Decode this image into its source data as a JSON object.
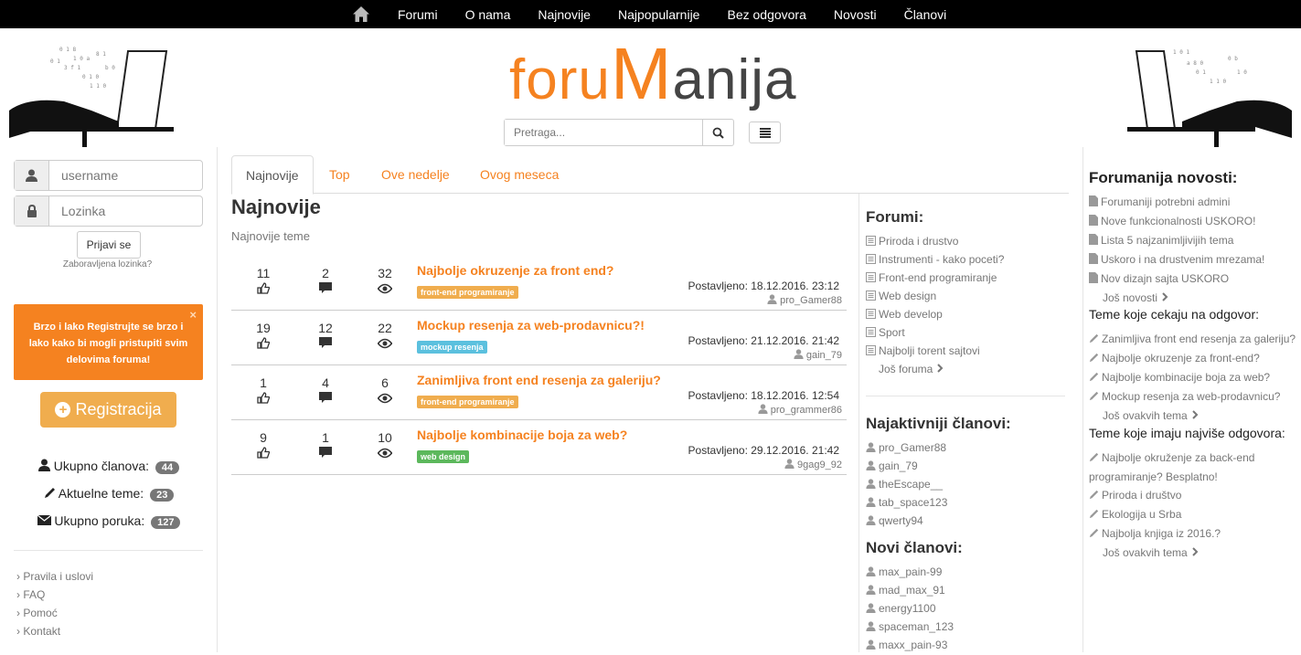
{
  "topnav": {
    "items": [
      "Forumi",
      "O nama",
      "Najnovije",
      "Najpopularnije",
      "Bez odgovora",
      "Novosti",
      "Članovi"
    ]
  },
  "logo": {
    "part1": "foru",
    "part2": "M",
    "part3": "anija"
  },
  "search": {
    "placeholder": "Pretraga..."
  },
  "login": {
    "username_placeholder": "username",
    "password_placeholder": "Lozinka",
    "button": "Prijavi se",
    "forgot": "Zaboravljena lozinka?"
  },
  "promo": {
    "bold": "Brzo i lako",
    "text": "Registrujte se brzo i lako kako bi mogli pristupiti svim delovima foruma!",
    "close": "×"
  },
  "register": {
    "label": "Registracija"
  },
  "stats": [
    {
      "label": "Ukupno članova:",
      "value": "44"
    },
    {
      "label": "Aktuelne teme:",
      "value": "23"
    },
    {
      "label": "Ukupno poruka:",
      "value": "127"
    }
  ],
  "leftlinks": [
    "Pravila i uslovi",
    "FAQ",
    "Pomoć",
    "Kontakt"
  ],
  "tabs": [
    "Najnovije",
    "Top",
    "Ove nedelje",
    "Ovog meseca"
  ],
  "main": {
    "title": "Najnovije",
    "subtitle": "Najnovije teme"
  },
  "topics": [
    {
      "likes": "11",
      "comments": "2",
      "views": "32",
      "title": "Najbolje okruzenje za front end?",
      "tag": "front-end programiranje",
      "tag_color": "#f0ad4e",
      "posted": "Postavljeno: 18.12.2016. 23:12",
      "author": "pro_Gamer88"
    },
    {
      "likes": "19",
      "comments": "12",
      "views": "22",
      "title": "Mockup resenja za web-prodavnicu?!",
      "tag": "mockup resenja",
      "tag_color": "#5bc0de",
      "posted": "Postavljeno: 21.12.2016. 21:42",
      "author": "gain_79"
    },
    {
      "likes": "1",
      "comments": "4",
      "views": "6",
      "title": "Zanimljiva front end resenja za galeriju?",
      "tag": "front-end programiranje",
      "tag_color": "#f0ad4e",
      "posted": "Postavljeno: 18.12.2016. 12:54",
      "author": "pro_grammer86"
    },
    {
      "likes": "9",
      "comments": "1",
      "views": "10",
      "title": "Najbolje kombinacije boja za web?",
      "tag": "web design",
      "tag_color": "#5cb85c",
      "posted": "Postavljeno: 29.12.2016. 21:42",
      "author": "9gag9_92"
    }
  ],
  "mid": {
    "forums_title": "Forumi:",
    "forums": [
      "Priroda i drustvo",
      "Instrumenti - kako poceti?",
      "Front-end programiranje",
      "Web design",
      "Web develop",
      "Sport",
      "Najbolji torent sajtovi"
    ],
    "forums_more": "Još foruma",
    "active_title": "Najaktivniji članovi:",
    "active": [
      "pro_Gamer88",
      "gain_79",
      "theEscape__",
      "tab_space123",
      "qwerty94"
    ],
    "new_title": "Novi članovi:",
    "new": [
      "max_pain-99",
      "mad_max_91",
      "energy1100",
      "spaceman_123",
      "maxx_pain-93"
    ]
  },
  "right": {
    "news_title": "Forumanija novosti:",
    "news": [
      "Forumaniji potrebni admini",
      "Nove funkcionalnosti USKORO!",
      "Lista 5 najzanimljivijih tema",
      "Uskoro i na drustvenim mrezama!",
      "Nov dizajn sajta USKORO"
    ],
    "news_more": "Još novosti",
    "waiting_title": "Teme koje cekaju na odgovor:",
    "waiting": [
      "Zanimljiva front end resenja za galeriju?",
      "Najbolje okruzenje za front-end?",
      "Najbolje kombinacije boja za web?",
      "Mockup resenja za web-prodavnicu?"
    ],
    "waiting_more": "Još ovakvih tema",
    "most_title": "Teme koje imaju najviše odgovora:",
    "most": [
      "Najbolje okruženje za back-end programiranje? Besplatno!",
      "Priroda i društvo",
      "Ekologija u Srba",
      "Najbolja knjiga iz 2016.?"
    ],
    "most_more": "Još ovakvih tema"
  }
}
